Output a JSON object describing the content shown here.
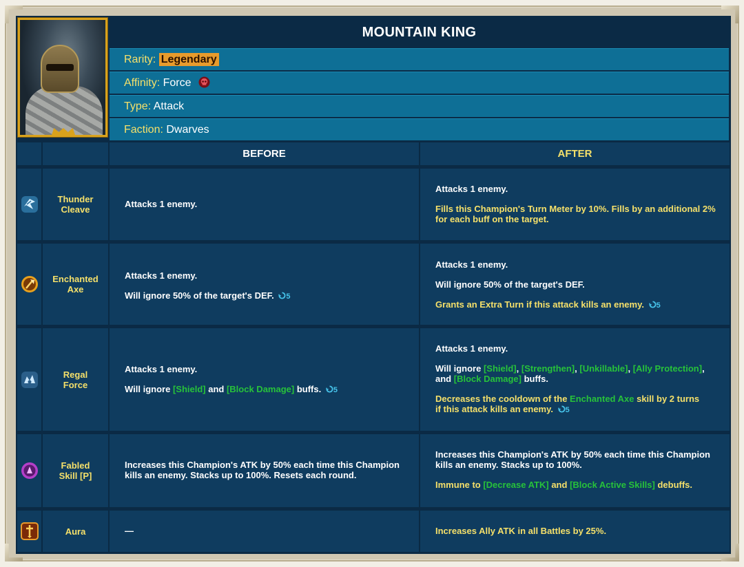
{
  "champion": {
    "name": "MOUNTAIN KING",
    "rarity_label": "Rarity:",
    "rarity_value": "Legendary",
    "affinity_label": "Affinity:",
    "affinity_value": "Force",
    "type_label": "Type:",
    "type_value": "Attack",
    "faction_label": "Faction:",
    "faction_value": "Dwarves"
  },
  "table": {
    "before_header": "BEFORE",
    "after_header": "AFTER"
  },
  "skills": [
    {
      "name_line1": "Thunder",
      "name_line2": "Cleave",
      "icon": "thunder-cleave-icon",
      "before": {
        "p1": "Attacks 1 enemy."
      },
      "after": {
        "p1": "Attacks 1 enemy.",
        "p2a": "Fills this Champion's Turn Meter by 10%. Fills by an additional 2%",
        "p2b": "for each buff on the target."
      }
    },
    {
      "name_line1": "Enchanted",
      "name_line2": "Axe",
      "icon": "enchanted-axe-icon",
      "before": {
        "p1": "Attacks 1 enemy.",
        "p2": "Will ignore 50% of the target's DEF.",
        "cooldown": "5"
      },
      "after": {
        "p1": "Attacks 1 enemy.",
        "p2": "Will ignore 50% of the target's DEF.",
        "p3": "Grants an Extra Turn if this attack kills an enemy.",
        "cooldown": "5"
      }
    },
    {
      "name_line1": "Regal",
      "name_line2": "Force",
      "icon": "regal-force-icon",
      "before": {
        "p1": "Attacks 1 enemy.",
        "p2_pre": "Will ignore ",
        "buff1": "[Shield]",
        "p2_mid": " and ",
        "buff2": "[Block Damage]",
        "p2_post": " buffs.",
        "cooldown": "5"
      },
      "after": {
        "p1": "Attacks 1 enemy.",
        "p2_pre": "Will ignore ",
        "buff1": "[Shield]",
        "sep1": ", ",
        "buff2": "[Strengthen]",
        "sep2": ", ",
        "buff3": "[Unkillable]",
        "sep3": ", ",
        "buff4": "[Ally Protection]",
        "sep4": ",",
        "and": "and ",
        "buff5": "[Block Damage]",
        "p2_post": " buffs.",
        "p3_pre": "Decreases the cooldown of the ",
        "skill_ref": "Enchanted Axe",
        "p3_mid": " skill by 2 turns",
        "p3_line2": "if this attack kills an enemy.",
        "cooldown": "5"
      }
    },
    {
      "name_line1": "Fabled",
      "name_line2": "Skill [P]",
      "icon": "fabled-skill-icon",
      "before": {
        "p1a": "Increases this Champion's ATK by 50% each time this Champion",
        "p1b": "kills an enemy. Stacks up to 100%. Resets each round."
      },
      "after": {
        "p1a": "Increases this Champion's ATK by 50% each time this Champion",
        "p1b": "kills an enemy. Stacks up to 100%.",
        "p2_pre": "Immune to ",
        "debuff1": "[Decrease ATK]",
        "p2_mid": " and ",
        "debuff2": "[Block Active Skills]",
        "p2_post": " debuffs."
      }
    },
    {
      "name_line1": "Aura",
      "name_line2": "",
      "icon": "aura-icon",
      "before": {
        "p1": "—"
      },
      "after": {
        "p1": "Increases Ally ATK in all Battles by 25%."
      }
    }
  ],
  "colors": {
    "background": "#0b2a45",
    "cell": "#0f3c5f",
    "attr_row": "#0e6f96",
    "highlight_yellow": "#f5e06a",
    "buff_green": "#27c23a",
    "cooldown_blue": "#46c3ea",
    "legendary_orange": "#e89b2c"
  }
}
